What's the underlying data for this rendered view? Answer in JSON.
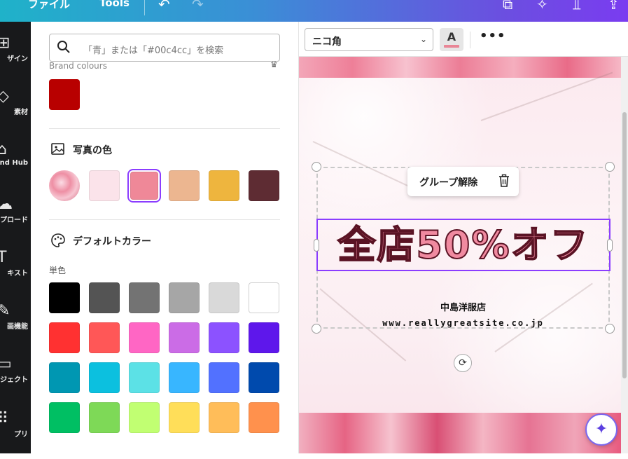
{
  "topbar": {
    "file_menu": "ファイル",
    "tools_menu": "Tools",
    "icons": [
      "undo-icon",
      "redo-icon",
      "resize-icon",
      "present-icon",
      "chart-icon",
      "share-icon"
    ]
  },
  "rail": {
    "items": [
      {
        "label": "ザイン",
        "icon": "layout-icon"
      },
      {
        "label": "素材",
        "icon": "shapes-icon"
      },
      {
        "label": "and Hub",
        "icon": "brand-hub-icon"
      },
      {
        "label": "プロード",
        "icon": "upload-icon"
      },
      {
        "label": "キスト",
        "icon": "text-icon"
      },
      {
        "label": "画機能",
        "icon": "draw-icon"
      },
      {
        "label": "ジェクト",
        "icon": "folder-icon"
      },
      {
        "label": "プリ",
        "icon": "apps-icon"
      }
    ]
  },
  "panel": {
    "search_placeholder": "「青」または「#00c4cc」を検索",
    "brand_colours_label": "Brand colours",
    "brand_colors": [
      "#b80000"
    ],
    "photo_colors_title": "写真の色",
    "photo_colors": [
      "#fbe3ea",
      "#ef8898",
      "#ecb690",
      "#eeb53e",
      "#5e2c33"
    ],
    "selected_photo_color": "#ef8898",
    "default_colors_title": "デフォルトカラー",
    "solid_label": "単色",
    "solid_colors": [
      [
        "#000000",
        "#545454",
        "#737373",
        "#a6a6a6",
        "#d9d9d9",
        "#ffffff"
      ],
      [
        "#ff3131",
        "#ff5757",
        "#ff66c4",
        "#cb6ce6",
        "#8c52ff",
        "#5e17eb"
      ],
      [
        "#0097b2",
        "#0cc0df",
        "#5ce1e6",
        "#38b6ff",
        "#5271ff",
        "#004aad"
      ],
      [
        "#00bf63",
        "#7ed957",
        "#c1ff72",
        "#ffde59",
        "#ffbd59",
        "#ff914d"
      ]
    ]
  },
  "toolbar": {
    "font_name": "ニコ角",
    "text_color_letter": "A",
    "text_color": "#e98696",
    "more": "•••"
  },
  "canvas": {
    "ungroup_label": "グループ解除",
    "headline": "全店50%オフ",
    "shop_name": "中島洋服店",
    "url": "www.reallygreatsite.co.jp"
  }
}
